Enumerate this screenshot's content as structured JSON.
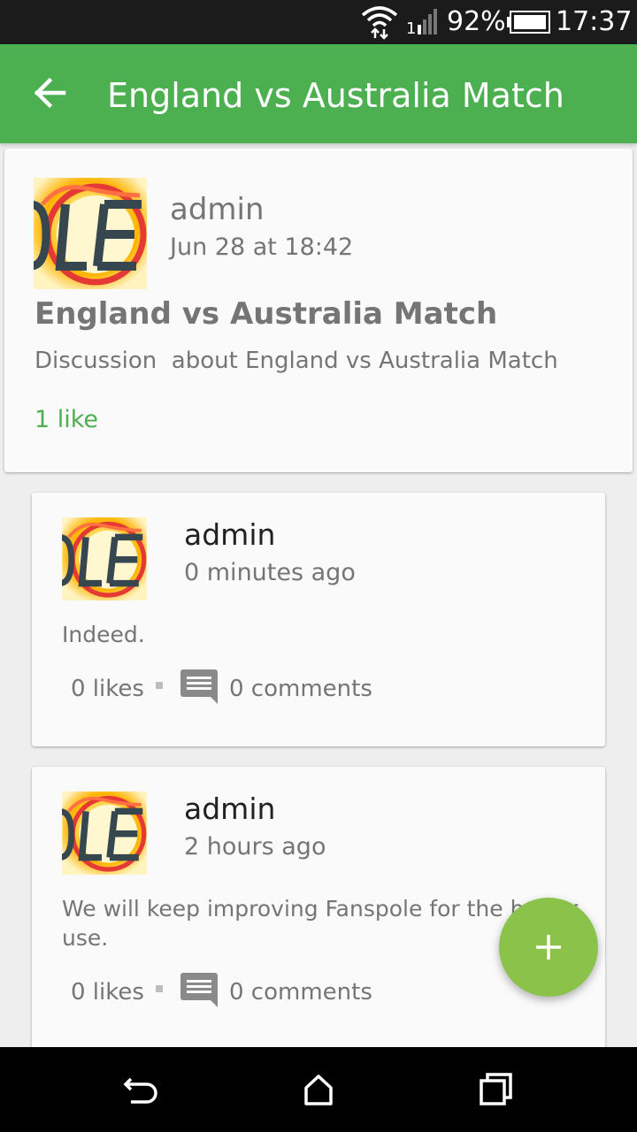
{
  "status_bar": {
    "battery_percent": "92%",
    "time": "17:37",
    "icons": [
      "wifi-icon",
      "signal-icon",
      "battery-icon"
    ]
  },
  "app_bar": {
    "title": "England vs Australia Match",
    "back_icon": "arrow-back-icon",
    "color": "#4caf50"
  },
  "post": {
    "author": "admin",
    "time": "Jun 28 at 18:42",
    "title": "England vs Australia Match",
    "description": "Discussion  about England vs Australia Match",
    "likes": "1 like"
  },
  "comments": [
    {
      "author": "admin",
      "time": "0 minutes ago",
      "body": "Indeed.",
      "likes": "0 likes",
      "comments": "0 comments"
    },
    {
      "author": "admin",
      "time": "2 hours ago",
      "body": "We will keep improving Fanspole for the better use.",
      "likes": "0 likes",
      "comments": "0 comments"
    }
  ],
  "fab": {
    "icon": "plus-icon",
    "color": "#8bc34a"
  },
  "nav_bar": {
    "icons": [
      "nav-back-icon",
      "nav-home-icon",
      "nav-recent-icon"
    ]
  }
}
